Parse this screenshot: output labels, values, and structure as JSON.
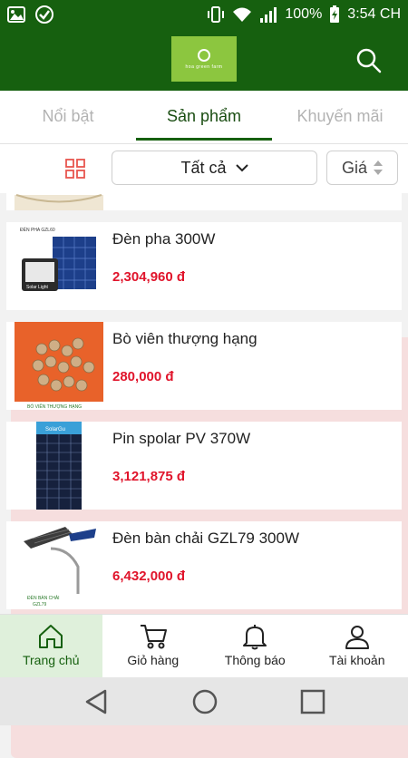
{
  "status_bar": {
    "battery": "100%",
    "time": "3:54 CH"
  },
  "header": {
    "logo_text": "hoa green farm",
    "search_icon": "search-icon"
  },
  "tabs": [
    {
      "label": "Nổi bật",
      "active": false
    },
    {
      "label": "Sản phẩm",
      "active": true
    },
    {
      "label": "Khuyến mãi",
      "active": false
    }
  ],
  "toolbar": {
    "filter_value": "Tất cả",
    "sort_label": "Giá"
  },
  "products": [
    {
      "name": "Đèn pha 300W",
      "price": "2,304,960 đ",
      "image_caption": "ĐÈN PHA GZL60",
      "panel_label": "Solar Light"
    },
    {
      "name": "Bò viên thượng hạng",
      "price": "280,000 đ",
      "image_caption": "BÒ VIÊN THƯỢNG HẠNG"
    },
    {
      "name": "Pin spolar PV 370W",
      "price": "3,121,875 đ",
      "brand": "SolarGu"
    },
    {
      "name": "Đèn bàn chải GZL79 300W",
      "price": "6,432,000 đ",
      "image_caption": "ĐÈN BÀN CHẢI",
      "image_caption_2": "GZL79"
    }
  ],
  "bottom_nav": [
    {
      "label": "Trang chủ",
      "icon": "home-icon",
      "active": true
    },
    {
      "label": "Giỏ hàng",
      "icon": "cart-icon",
      "active": false
    },
    {
      "label": "Thông báo",
      "icon": "bell-icon",
      "active": false
    },
    {
      "label": "Tài khoản",
      "icon": "user-icon",
      "active": false
    }
  ],
  "colors": {
    "primary": "#16600f",
    "accent_logo": "#8cc63f",
    "price": "#e0142b"
  }
}
